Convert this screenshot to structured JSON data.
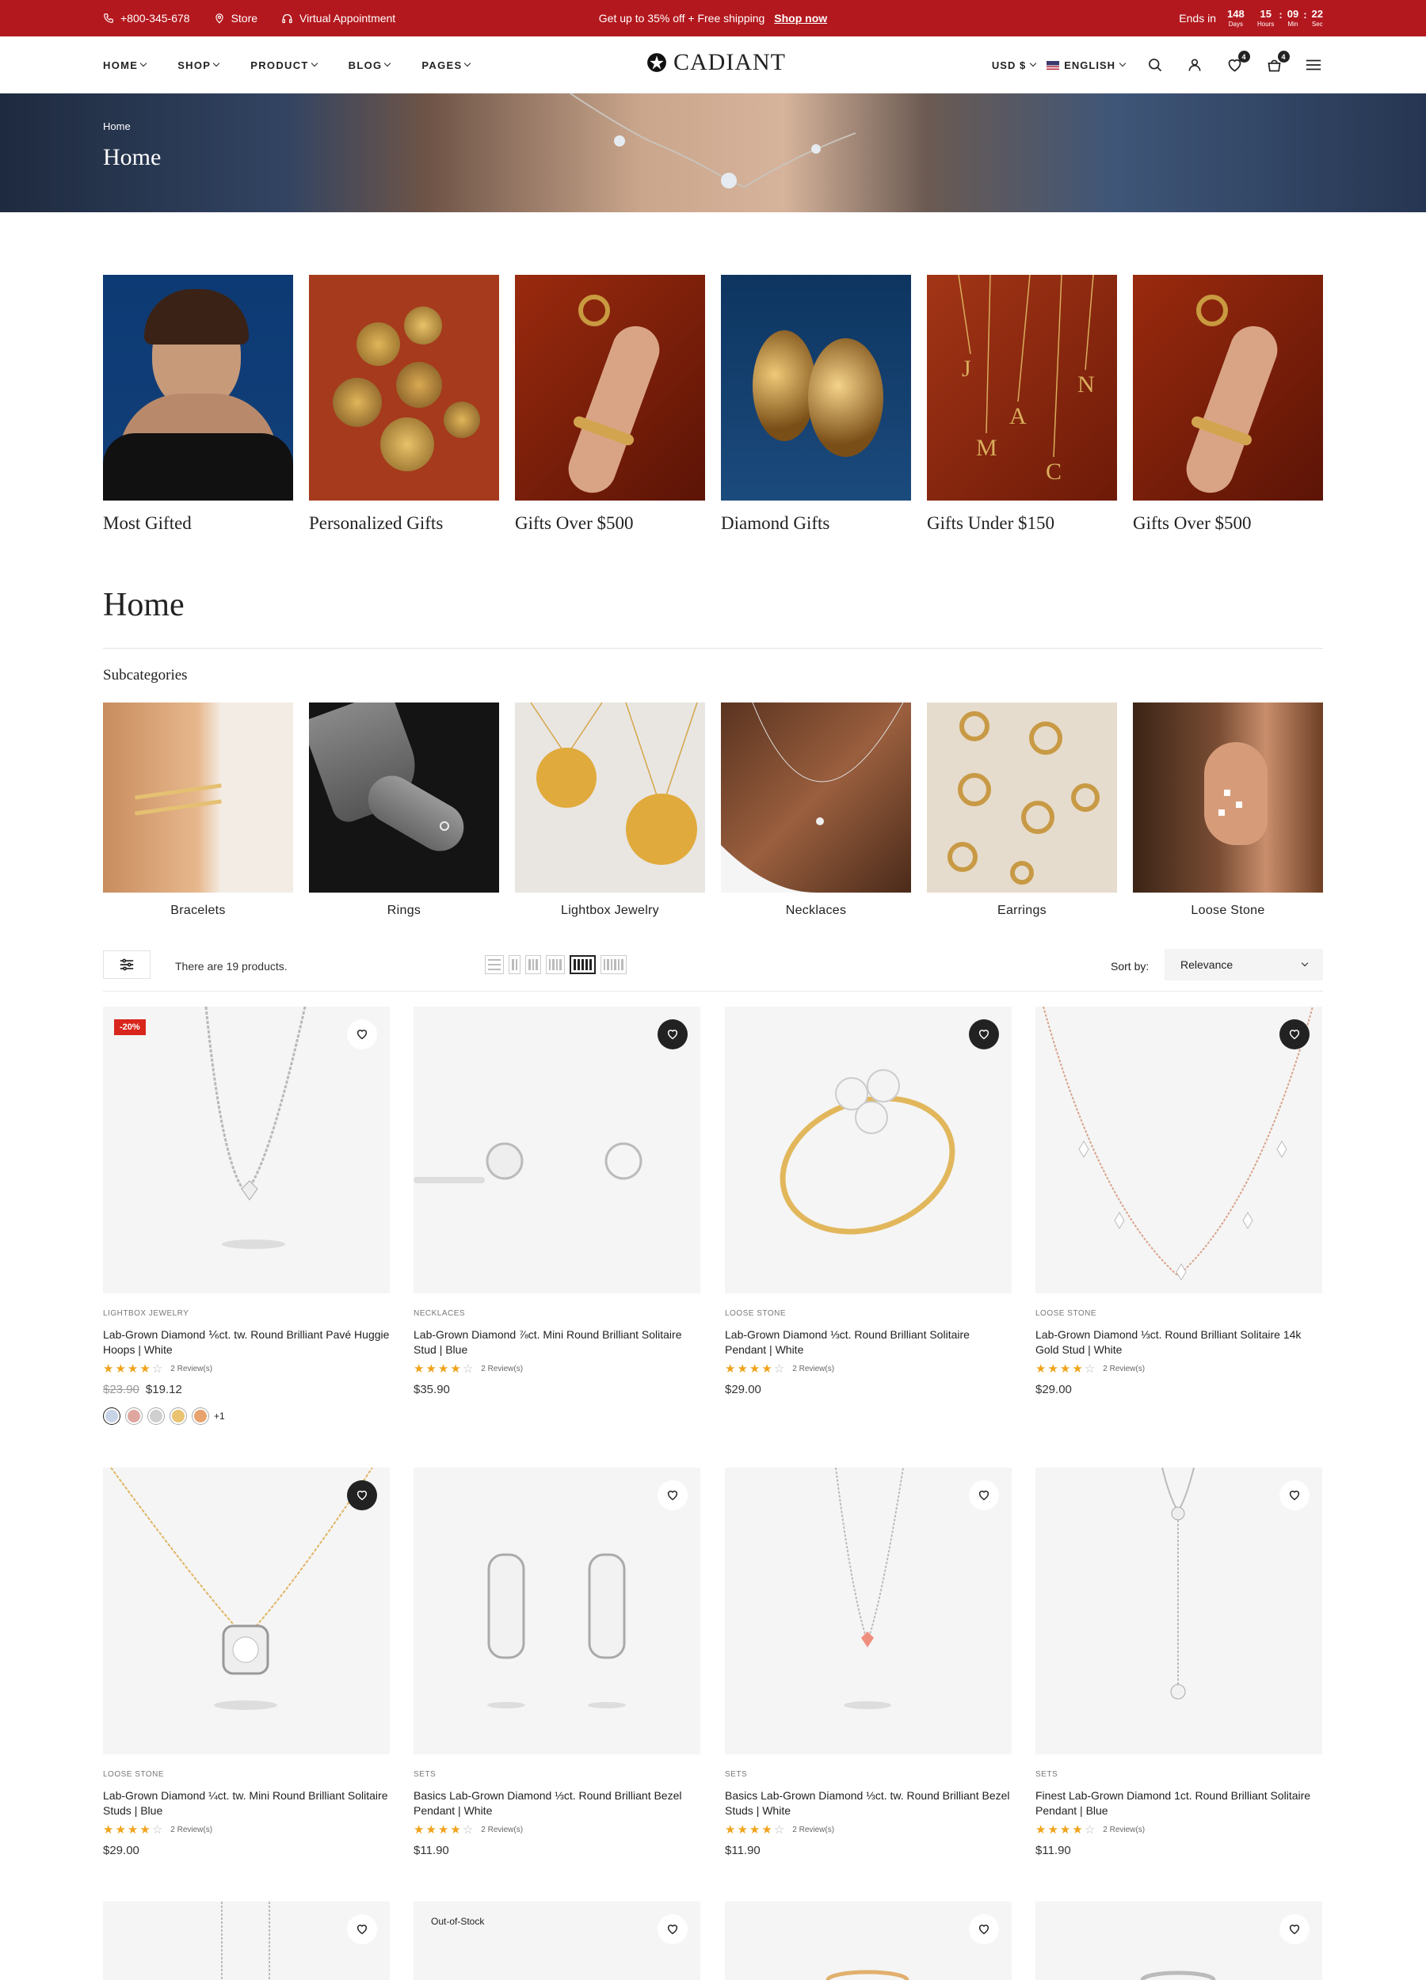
{
  "topbar": {
    "phone": "+800-345-678",
    "store": "Store",
    "virtual": "Virtual Appointment",
    "promo": "Get up to 35% off + Free shipping",
    "shop_now": "Shop now",
    "ends_in": "Ends in",
    "countdown": [
      {
        "v": "148",
        "u": "Days"
      },
      {
        "v": "15",
        "u": "Hours"
      },
      {
        "v": "09",
        "u": "Min"
      },
      {
        "v": "22",
        "u": "Sec"
      }
    ]
  },
  "nav": [
    "HOME",
    "SHOP",
    "PRODUCT",
    "BLOG",
    "PAGES"
  ],
  "logo": "CADIANT",
  "header": {
    "currency": "USD $",
    "language": "ENGLISH",
    "wishlist_count": "4",
    "cart_count": "4"
  },
  "hero": {
    "breadcrumb": "Home",
    "title": "Home"
  },
  "gifts": [
    "Most Gifted",
    "Personalized Gifts",
    "Gifts Over $500",
    "Diamond Gifts",
    "Gifts Under $150",
    "Gifts Over $500"
  ],
  "page_title": "Home",
  "subcategories_title": "Subcategories",
  "subcategories": [
    "Bracelets",
    "Rings",
    "Lightbox Jewelry",
    "Necklaces",
    "Earrings",
    "Loose Stone"
  ],
  "toolbar": {
    "count": "There are 19 products.",
    "sort_label": "Sort by:",
    "sort_value": "Relevance"
  },
  "products": [
    {
      "cat": "LIGHTBOX JEWELRY",
      "name": "Lab-Grown Diamond ⅙ct. tw. Round Brilliant Pavé Huggie Hoops | White",
      "reviews": "2 Review(s)",
      "old": "$23.90",
      "price": "$19.12",
      "sale": "-20%",
      "more": "+1",
      "stars": 4
    },
    {
      "cat": "NECKLACES",
      "name": "Lab-Grown Diamond ⅞ct. Mini Round Brilliant Solitaire Stud | Blue",
      "reviews": "2 Review(s)",
      "price": "$35.90",
      "stars": 4
    },
    {
      "cat": "LOOSE STONE",
      "name": "Lab-Grown Diamond ⅓ct. Round Brilliant Solitaire Pendant | White",
      "reviews": "2 Review(s)",
      "price": "$29.00",
      "stars": 4
    },
    {
      "cat": "LOOSE STONE",
      "name": "Lab-Grown Diamond ⅓ct. Round Brilliant Solitaire 14k Gold Stud | White",
      "reviews": "2 Review(s)",
      "price": "$29.00",
      "stars": 4
    },
    {
      "cat": "LOOSE STONE",
      "name": "Lab-Grown Diamond ¼ct. tw. Mini Round Brilliant Solitaire Studs | Blue",
      "reviews": "2 Review(s)",
      "price": "$29.00",
      "stars": 4
    },
    {
      "cat": "SETS",
      "name": "Basics Lab-Grown Diamond ⅓ct. Round Brilliant Bezel Pendant | White",
      "reviews": "2 Review(s)",
      "price": "$11.90",
      "stars": 4
    },
    {
      "cat": "SETS",
      "name": "Basics Lab-Grown Diamond ⅓ct. tw. Round Brilliant Bezel Studs | White",
      "reviews": "2 Review(s)",
      "price": "$11.90",
      "stars": 4
    },
    {
      "cat": "SETS",
      "name": "Finest Lab-Grown Diamond 1ct. Round Brilliant Solitaire Pendant | Blue",
      "reviews": "2 Review(s)",
      "price": "$11.90",
      "stars": 4
    }
  ],
  "out_of_stock": "Out-of-Stock"
}
